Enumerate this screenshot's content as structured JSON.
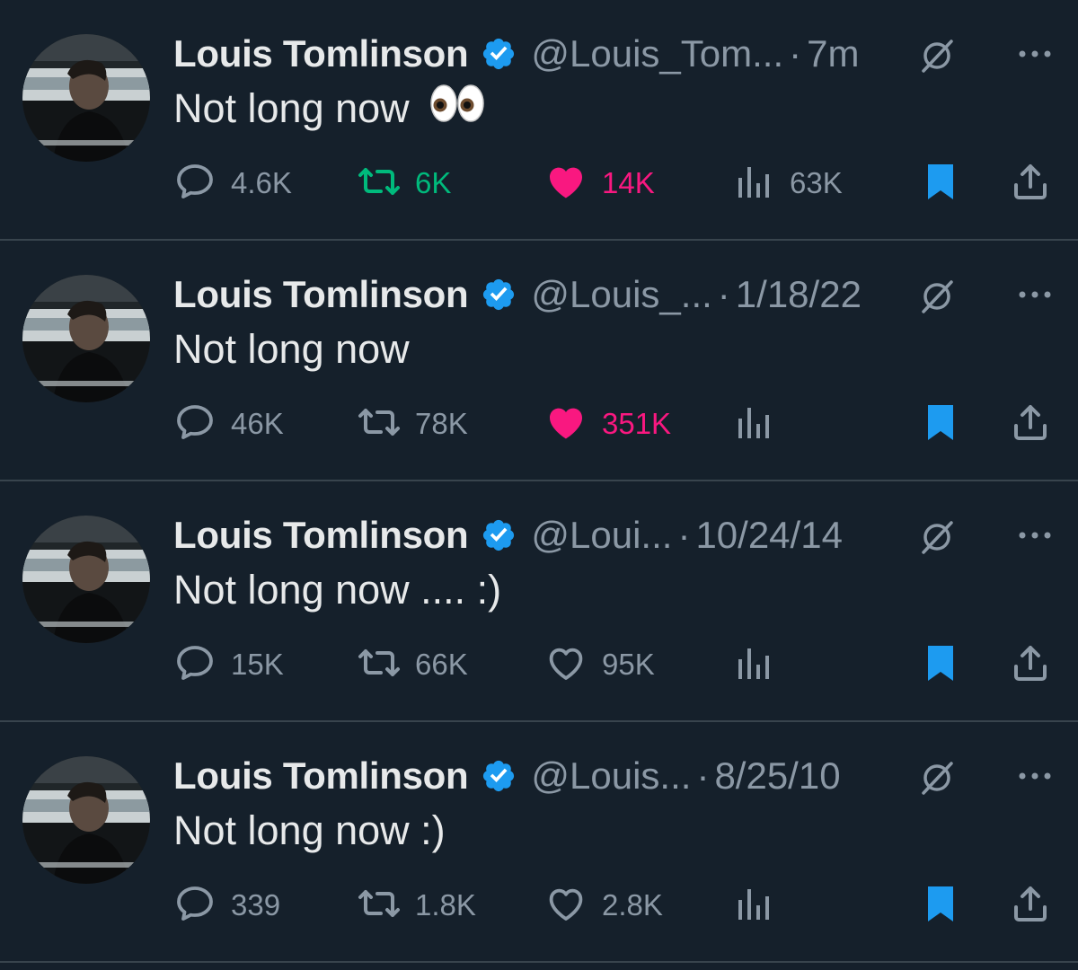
{
  "colors": {
    "background": "#15202b",
    "verified": "#1d9bf0",
    "retweeted": "#00ba7c",
    "liked": "#f91880",
    "bookmarked": "#1d9bf0",
    "muted": "#8b98a5"
  },
  "tweets": [
    {
      "name": "Louis Tomlinson",
      "handle": "@Louis_Tom...",
      "dot": "·",
      "time": "7m",
      "text": "Not long now",
      "emoji": "eyes-emoji",
      "replies": "4.6K",
      "retweets": "6K",
      "retweeted": true,
      "likes": "14K",
      "liked": true,
      "views": "63K",
      "bookmarked": true
    },
    {
      "name": "Louis Tomlinson",
      "handle": "@Louis_...",
      "dot": "·",
      "time": "1/18/22",
      "text": "Not long now",
      "replies": "46K",
      "retweets": "78K",
      "retweeted": false,
      "likes": "351K",
      "liked": true,
      "views": "",
      "bookmarked": true
    },
    {
      "name": "Louis Tomlinson",
      "handle": "@Loui...",
      "dot": "·",
      "time": "10/24/14",
      "text": "Not long now .... :)",
      "replies": "15K",
      "retweets": "66K",
      "retweeted": false,
      "likes": "95K",
      "liked": false,
      "views": "",
      "bookmarked": true
    },
    {
      "name": "Louis Tomlinson",
      "handle": "@Louis...",
      "dot": "·",
      "time": "8/25/10",
      "text": "Not long now :)",
      "replies": "339",
      "retweets": "1.8K",
      "retweeted": false,
      "likes": "2.8K",
      "liked": false,
      "views": "",
      "bookmarked": true
    }
  ],
  "icons": {
    "verified": "verified-badge-icon",
    "grok": "grok-icon",
    "more": "more-icon",
    "reply": "reply-icon",
    "retweet": "retweet-icon",
    "like": "heart-icon",
    "views": "views-icon",
    "bookmark": "bookmark-icon",
    "share": "share-icon"
  }
}
